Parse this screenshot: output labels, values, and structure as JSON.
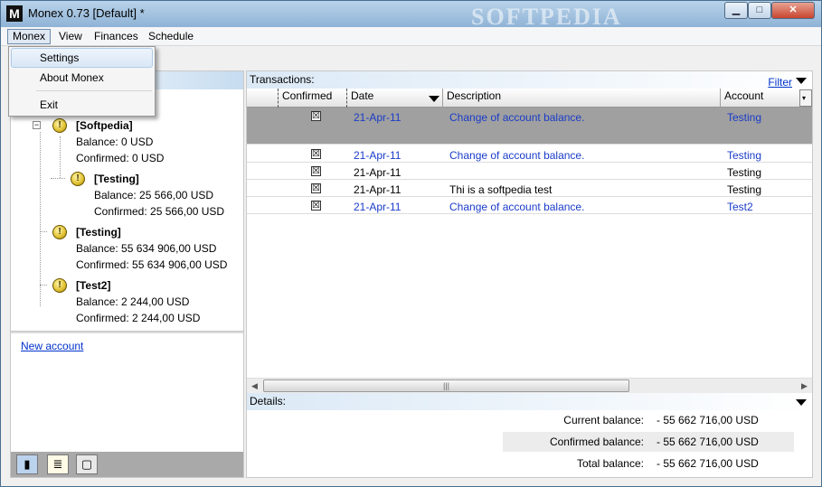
{
  "window": {
    "title": "Monex 0.73 [Default] *",
    "app_icon": "M",
    "watermark": "SOFTPEDIA"
  },
  "menubar": {
    "items": [
      "Monex",
      "View",
      "Finances",
      "Schedule"
    ]
  },
  "dropdown": {
    "items": [
      "Settings",
      "About Monex",
      "Exit"
    ]
  },
  "accounts_panel": {
    "tree": [
      {
        "name": "[Softpedia]",
        "balance_label": "Balance:",
        "balance": "0  USD",
        "confirmed_label": "Confirmed:",
        "confirmed": "0  USD"
      },
      {
        "name": "[Testing]",
        "balance_label": "Balance:",
        "balance": "25 566,00  USD",
        "confirmed_label": "Confirmed:",
        "confirmed": "25 566,00  USD"
      },
      {
        "name": "[Testing]",
        "balance_label": "Balance:",
        "balance": "55 634 906,00  USD",
        "confirmed_label": "Confirmed:",
        "confirmed": "55 634 906,00  USD"
      },
      {
        "name": "[Test2]",
        "balance_label": "Balance:",
        "balance": "2 244,00  USD",
        "confirmed_label": "Confirmed:",
        "confirmed": "2 244,00  USD"
      }
    ],
    "new_account": "New account"
  },
  "transactions": {
    "label": "Transactions:",
    "filter": "Filter",
    "columns": {
      "confirmed": "Confirmed",
      "date": "Date",
      "description": "Description",
      "account": "Account"
    },
    "rows": [
      {
        "confirmed": true,
        "date": "21-Apr-11",
        "description": "Change of account balance.",
        "account": "Testing"
      },
      {
        "confirmed": true,
        "date": "21-Apr-11",
        "description": "Change of account balance.",
        "account": "Testing"
      },
      {
        "confirmed": true,
        "date": "21-Apr-11",
        "description": "",
        "account": "Testing"
      },
      {
        "confirmed": true,
        "date": "21-Apr-11",
        "description": "Thi is a softpedia test",
        "account": "Testing"
      },
      {
        "confirmed": true,
        "date": "21-Apr-11",
        "description": "Change of account balance.",
        "account": "Test2"
      }
    ],
    "check_mark": "☒"
  },
  "details": {
    "label": "Details:",
    "current_label": "Current balance:",
    "current_value": "- 55 662 716,00  USD",
    "confirmed_label": "Confirmed balance:",
    "confirmed_value": "- 55 662 716,00  USD",
    "total_label": "Total balance:",
    "total_value": "- 55 662 716,00  USD"
  }
}
